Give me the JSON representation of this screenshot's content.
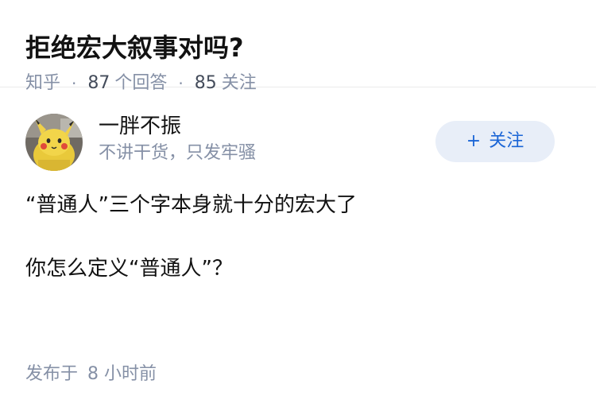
{
  "question": {
    "title": "拒绝宏大叙事对吗?",
    "source": "知乎",
    "answer_count": "87",
    "answer_label": "个回答",
    "follower_count": "85",
    "follower_label": "关注",
    "separator": "·"
  },
  "answer": {
    "author": {
      "name": "一胖不振",
      "bio": "不讲干货，只发牢骚",
      "avatar_icon": "pikachu-plush-avatar"
    },
    "follow_button": {
      "plus": "+",
      "label": "关注"
    },
    "paragraphs": [
      "“普通人”三个字本身就十分的宏大了",
      "你怎么定义“普通人”？"
    ],
    "published_label": "发布于",
    "published_time": "8 小时前"
  },
  "colors": {
    "title": "#121212",
    "meta": "#8590a6",
    "follow_bg": "#e8eef8",
    "follow_text": "#1a65d6"
  }
}
